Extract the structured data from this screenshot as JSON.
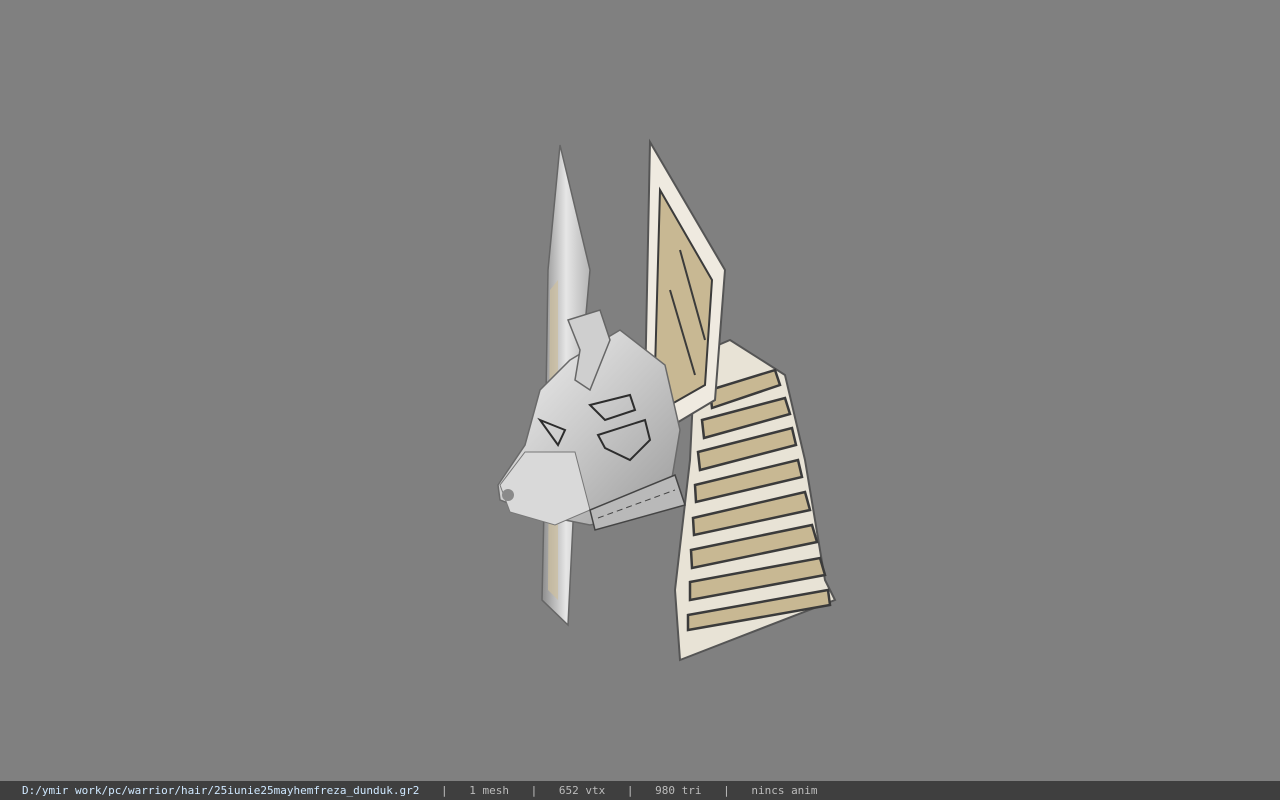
{
  "viewer": {
    "background_color": "#808080",
    "model_icon": "anubis-helmet-model"
  },
  "status": {
    "path": "D:/ymir work/pc/warrior/hair/25iunie25mayhemfreza_dunduk.gr2",
    "separator": "|",
    "mesh": "1 mesh",
    "vtx": "652 vtx",
    "tri": "980 tri",
    "anim": "nincs anim"
  },
  "colors": {
    "status_bg": "#3f3f3f",
    "path_text": "#cfe8ff",
    "stat_text": "#bcbcbc"
  }
}
